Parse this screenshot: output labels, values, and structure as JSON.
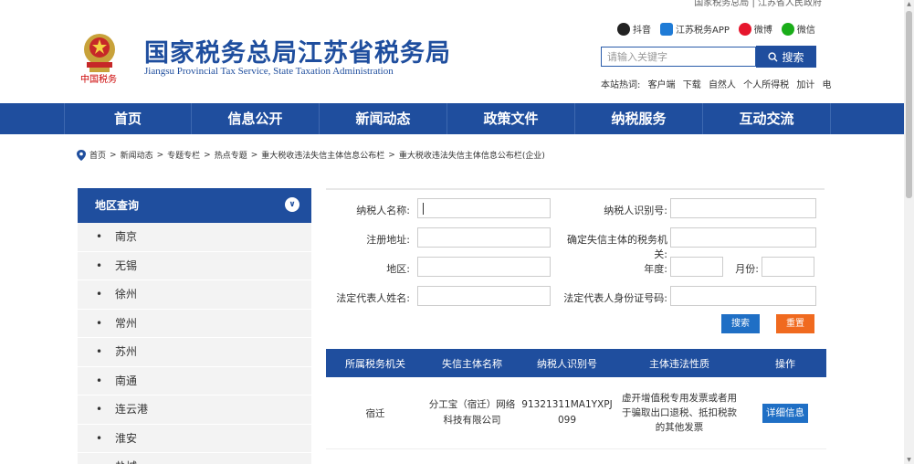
{
  "top_links": "国家税务总局 | 江苏省人民政府",
  "header": {
    "title_cn": "国家税务总局江苏省税务局",
    "title_en": "Jiangsu Provincial Tax Service, State Taxation Administration",
    "emblem_text": "中国税务",
    "social": [
      {
        "label": "抖音",
        "color": "#222222",
        "icon": "douyin-icon"
      },
      {
        "label": "江苏税务APP",
        "color": "#1f7bd6",
        "icon": "app-icon"
      },
      {
        "label": "微博",
        "color": "#e6162d",
        "icon": "weibo-icon"
      },
      {
        "label": "微信",
        "color": "#1aad19",
        "icon": "wechat-icon"
      }
    ],
    "search_placeholder": "请输入关键字",
    "search_button": "搜索",
    "hot_prefix": "本站热词:",
    "hot_words": [
      "客户端",
      "下载",
      "自然人",
      "个人所得税",
      "加计",
      "电"
    ]
  },
  "nav": [
    "首页",
    "信息公开",
    "新闻动态",
    "政策文件",
    "纳税服务",
    "互动交流"
  ],
  "breadcrumb": [
    "首页",
    "新闻动态",
    "专题专栏",
    "热点专题",
    "重大税收违法失信主体信息公布栏",
    "重大税收违法失信主体信息公布栏(企业)"
  ],
  "sidebar": {
    "title": "地区查询",
    "items": [
      "南京",
      "无锡",
      "徐州",
      "常州",
      "苏州",
      "南通",
      "连云港",
      "淮安",
      "盐城"
    ]
  },
  "form": {
    "taxpayer_name": "纳税人名称:",
    "taxpayer_id": "纳税人识别号:",
    "reg_address": "注册地址:",
    "authority": "确定失信主体的税务机关:",
    "region": "地区:",
    "year": "年度:",
    "month": "月份:",
    "legal_rep": "法定代表人姓名:",
    "legal_rep_id": "法定代表人身份证号码:",
    "search_btn": "搜索",
    "reset_btn": "重置"
  },
  "table": {
    "headers": [
      "所属税务机关",
      "失信主体名称",
      "纳税人识别号",
      "主体违法性质",
      "操作"
    ],
    "rows": [
      {
        "authority": "宿迁",
        "name": "分工宝（宿迁）网络科技有限公司",
        "tax_id": "91321311MA1YXPJ099",
        "nature": "虚开增值税专用发票或者用于骗取出口退税、抵扣税款的其他发票",
        "action": "详细信息"
      }
    ]
  },
  "colors": {
    "primary": "#1f4e9e",
    "button_blue": "#1f6fc5",
    "button_orange": "#f06a1f"
  }
}
